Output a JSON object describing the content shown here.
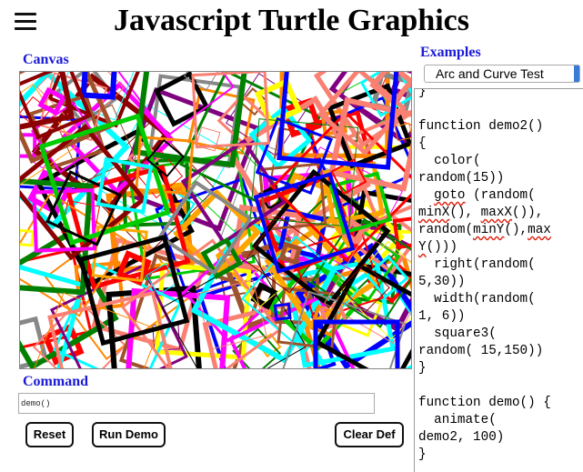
{
  "app": {
    "title": "Javascript Turtle Graphics"
  },
  "menu": {
    "icon": "hamburger-menu-icon"
  },
  "canvas": {
    "label": "Canvas",
    "colors": [
      "#ff0000",
      "#00cc00",
      "#0000ff",
      "#ff00ff",
      "#00ffff",
      "#ffff00",
      "#ff8800",
      "#888888",
      "#a0522d",
      "#fa8072",
      "#008000",
      "#000000",
      "#8b0000",
      "#800080",
      "#ffa500"
    ]
  },
  "examples": {
    "label": "Examples",
    "selected": "Arc and Curve Test",
    "code_lines": [
      "}",
      "",
      "function demo2()",
      "{",
      "  color(",
      "random(15))",
      "  goto (random(",
      "minX(), maxX()),",
      "random(minY(),max",
      "Y()))",
      "  right(random(",
      "5,30))",
      "  width(random(",
      "1, 6))",
      "  square3(",
      "random( 15,150))",
      "}",
      "",
      "function demo() {",
      "  animate(",
      "demo2, 100)",
      "}"
    ]
  },
  "command": {
    "label": "Command",
    "value": "demo()"
  },
  "buttons": {
    "reset": "Reset",
    "run_demo": "Run Demo",
    "clear_def": "Clear Def"
  }
}
